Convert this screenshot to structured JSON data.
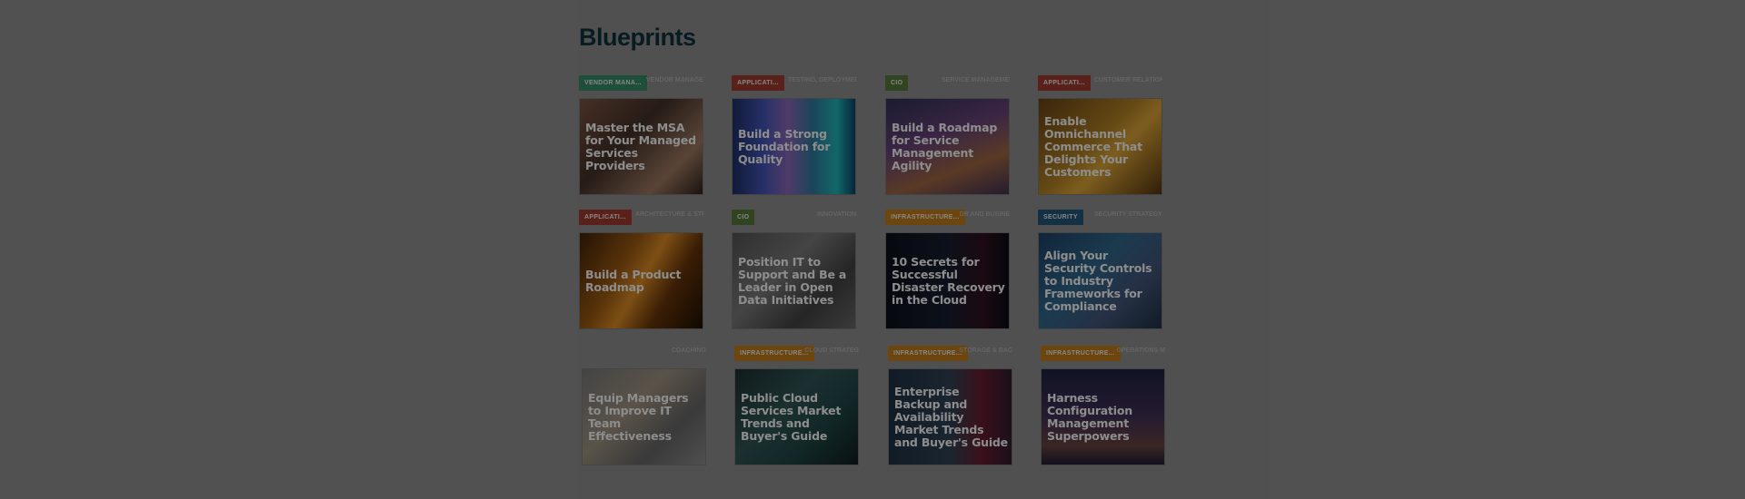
{
  "page": {
    "title": "Blueprints"
  },
  "cards": [
    {
      "tag": "VENDOR MANA...",
      "tag_color": "#2d7a5a",
      "category": "VENDOR MANAGE",
      "title": "Master the MSA for Your Managed Services Providers",
      "bg": "linear-gradient(135deg,#6b4a3a 0%,#3a2a22 40%,#8a6a55 75%,#2a1e18 100%)"
    },
    {
      "tag": "APPLICATI...",
      "tag_color": "#8a3328",
      "category": "TESTING, DEPLOYMENT",
      "title": "Build a Strong Foundation for Quality",
      "bg": "linear-gradient(90deg,#1a2a5a 0%,#3a4aa0 25%,#7a5aa0 45%,#2a6a8a 65%,#1aa0a0 85%,#0a3a5a 100%)"
    },
    {
      "tag": "CIO",
      "tag_color": "#4a6a30",
      "category": "SERVICE MANAGEMENT",
      "title": "Build a Roadmap for Service Management Agility",
      "bg": "linear-gradient(160deg,#2a2a4a 0%,#5a3a6a 40%,#8a5a3a 70%,#3a2a4a 100%)"
    },
    {
      "tag": "APPLICATI...",
      "tag_color": "#8a3328",
      "category": "CUSTOMER RELATION",
      "title": "Enable Omnichannel Commerce That Delights Your Customers",
      "bg": "linear-gradient(135deg,#5a3a10 0%,#9a7020 45%,#c09030 60%,#4a2e0e 100%)"
    },
    {
      "tag": "APPLICATI...",
      "tag_color": "#8a3328",
      "category": "ARCHITECTURE & STRA",
      "title": "Build a Product Roadmap",
      "bg": "linear-gradient(120deg,#3a1e08 0%,#8a5010 35%,#c07a20 50%,#5a2e08 70%,#1a0e04 100%)"
    },
    {
      "tag": "CIO",
      "tag_color": "#4a6a30",
      "category": "INNOVATION",
      "title": "Position IT to Support and Be a Leader in Open Data Initiatives",
      "bg": "linear-gradient(135deg,#4a4a4a 0%,#6a6a6a 40%,#3a3a3a 70%,#5a5a5a 100%)"
    },
    {
      "tag": "INFRASTRUCTURE...",
      "tag_color": "#a86a18",
      "category": "DR AND BUSINE",
      "title": "10 Secrets for Successful Disaster Recovery in the Cloud",
      "bg": "linear-gradient(90deg,#0a0e18 0%,#141a2a 50%,#2a0e1a 80%,#0a0a14 100%)"
    },
    {
      "tag": "SECURITY",
      "tag_color": "#1e4a6a",
      "category": "SECURITY STRATEGY & B",
      "title": "Align Your Security Controls to Industry Frameworks for Compliance",
      "bg": "linear-gradient(135deg,#1a3a5a 0%,#2a5a7a 40%,#3a4a6a 70%,#1a2a3a 100%)"
    },
    {
      "tag": "",
      "tag_color": "",
      "category": "COACHING",
      "title": "Equip Managers to Improve IT Team Effectiveness",
      "bg": "linear-gradient(135deg,#6a6a6a 0%,#8a8070 40%,#5a5a5a 70%,#7a7a7a 100%)"
    },
    {
      "tag": "INFRASTRUCTURE...",
      "tag_color": "#a86a18",
      "category": "CLOUD STRATEG",
      "title": "Public Cloud Services Market Trends and Buyer's Guide",
      "bg": "linear-gradient(135deg,#1a2a2a 0%,#2a4a4a 40%,#1a3a3a 70%,#0e1a1a 100%)"
    },
    {
      "tag": "INFRASTRUCTURE...",
      "tag_color": "#a86a18",
      "category": "STORAGE & BAC",
      "title": "Enterprise Backup and Availability Market Trends and Buyer's Guide",
      "bg": "linear-gradient(90deg,#1a2a3a 0%,#2a3a4a 50%,#5a1a2a 75%,#2a1a2a 100%)"
    },
    {
      "tag": "INFRASTRUCTURE...",
      "tag_color": "#a86a18",
      "category": "OPERATIONS M",
      "title": "Harness Configuration Management Superpowers",
      "bg": "linear-gradient(180deg,#1a1e3a 0%,#3a2a4a 50%,#5a3a3a 80%,#1a1a2a 100%)"
    }
  ]
}
